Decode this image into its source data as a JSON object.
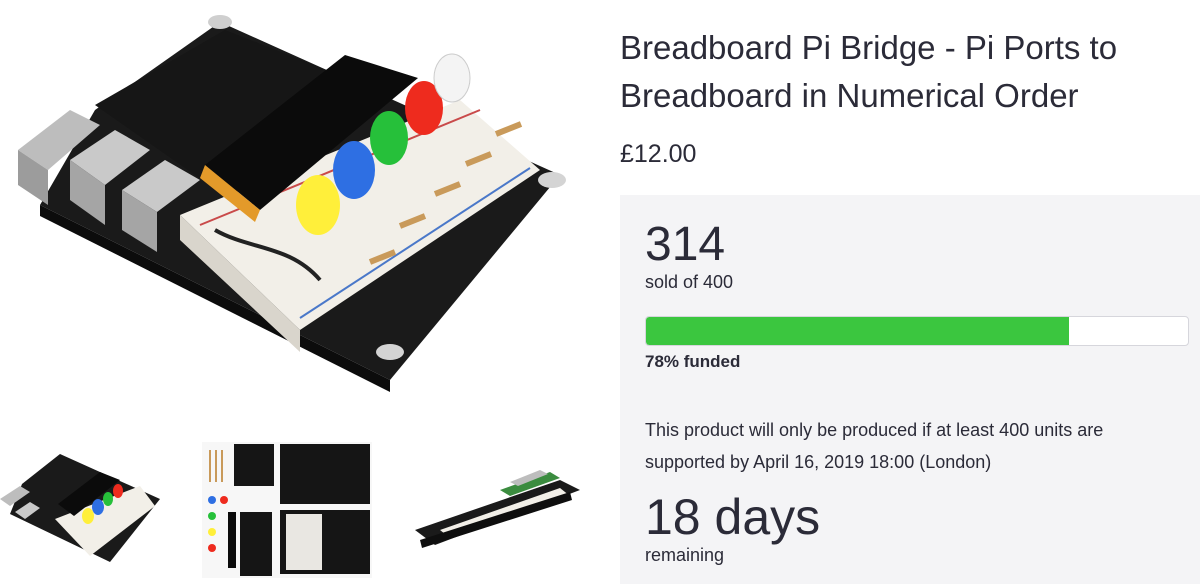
{
  "product": {
    "title": "Breadboard Pi Bridge - Pi Ports to Breadboard in Numerical Order",
    "price": "£12.00"
  },
  "funding": {
    "sold": "314",
    "sold_label": "sold of 400",
    "funded_fraction": 0.78,
    "funded_label": "78% funded",
    "notice": "This product will only be produced if at least 400 units are supported by April 16, 2019 18:00 (London)",
    "days_remaining": "18 days",
    "days_label": "remaining"
  },
  "gallery": {
    "thumbnails": [
      "assembled-kit-photo",
      "kit-parts-photo",
      "side-view-photo"
    ]
  },
  "colors": {
    "progress_green": "#3bc63f",
    "panel_bg": "#f4f4f6",
    "text": "#2b2b38"
  }
}
